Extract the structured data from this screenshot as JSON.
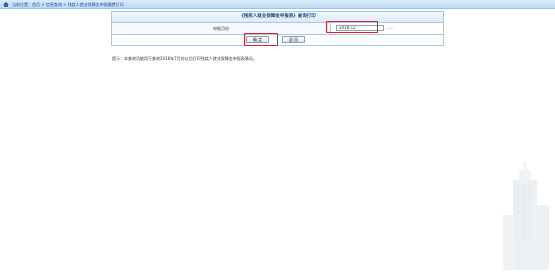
{
  "topbar": {
    "breadcrumb": "当前位置：首页 > 信息查询 > 残疾人就业保障金申报缴费打印"
  },
  "panel": {
    "title": "《残疾人就业保障金申报表》查询打印",
    "month_label": "申报月份",
    "month_value": "2018-12",
    "picker": "……",
    "confirm_label": "确 定",
    "return_label": "返 回"
  },
  "hint": "提示：本查询功能用于查询2018年7月份以后打印残疾人就业保障金申报表情况。"
}
